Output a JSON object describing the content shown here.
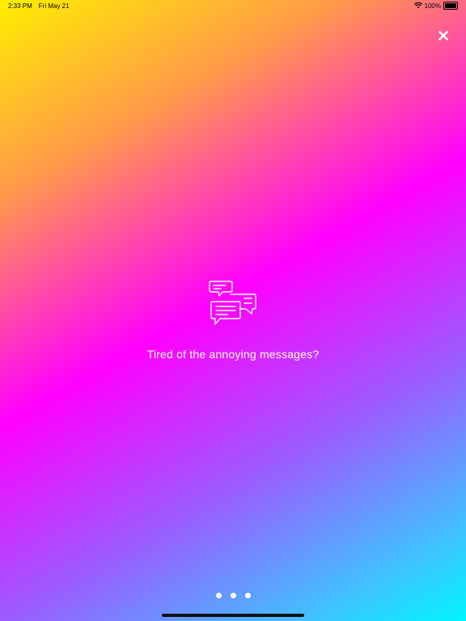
{
  "status_bar": {
    "time": "2:33 PM",
    "date": "Fri May 21",
    "battery_text": "100%",
    "wifi_icon": "wifi-icon",
    "battery_icon": "battery-icon",
    "battery_level": 1.0
  },
  "close_button": {
    "icon": "close-icon",
    "color": "#ffffff"
  },
  "onboarding": {
    "icon": "chat-bubbles-icon",
    "message": "Tired of the annoying messages?",
    "page_count": 3
  },
  "colors": {
    "text": "#ffffff",
    "gradient": [
      "#ffee00",
      "#ff9a4a",
      "#ff00ff",
      "#9b5cff",
      "#3ec4ff",
      "#00f5ff"
    ]
  }
}
